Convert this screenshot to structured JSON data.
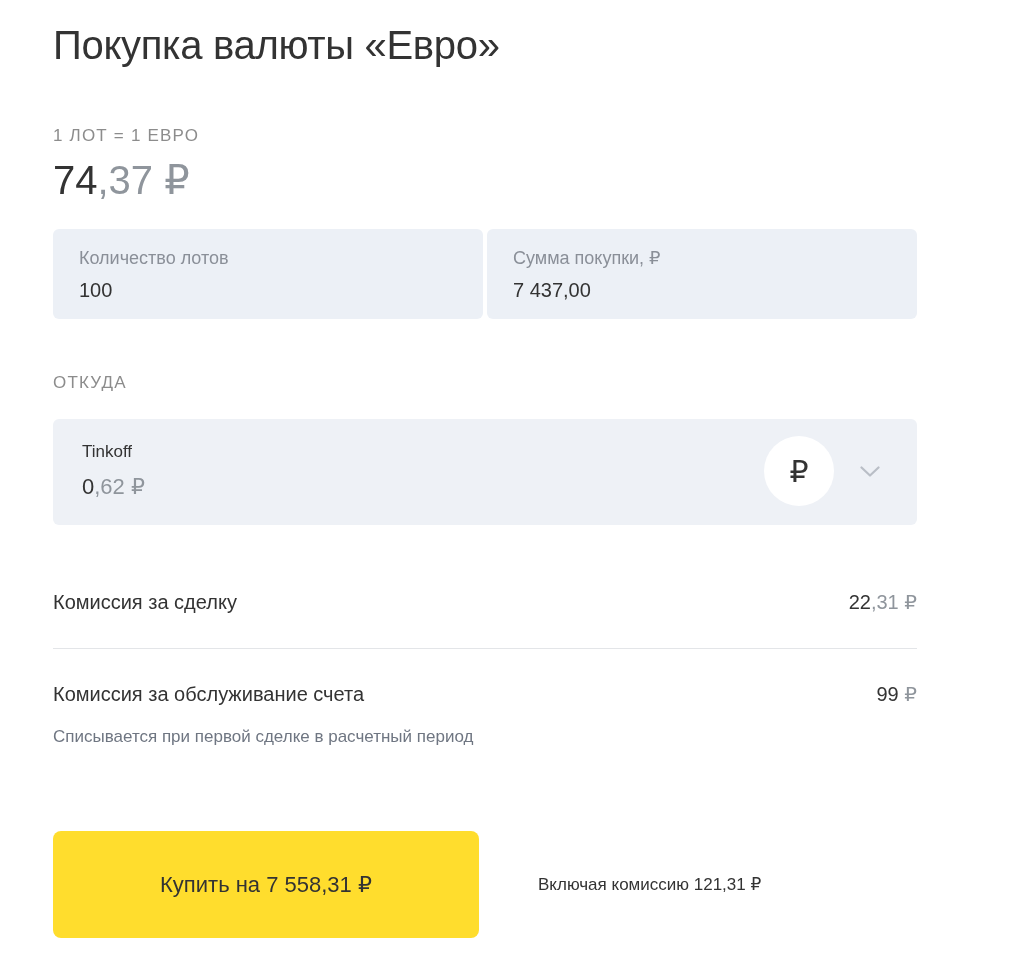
{
  "title": "Покупка валюты «Евро»",
  "rate": {
    "caption": "1 ЛОТ = 1 ЕВРО",
    "whole": "74",
    "fraction": ",37 ₽"
  },
  "fields": [
    {
      "label": "Количество лотов",
      "value": "100"
    },
    {
      "label": "Сумма покупки, ₽",
      "value": "7 437,00"
    }
  ],
  "source": {
    "heading": "ОТКУДА",
    "account": "Tinkoff",
    "balance_whole": "0",
    "balance_fraction": ",62 ₽",
    "currency_icon": "₽"
  },
  "fees": [
    {
      "label": "Комиссия за сделку",
      "whole": "22",
      "fraction": ",31 ₽"
    },
    {
      "label": "Комиссия за обслуживание счета",
      "whole": "99",
      "fraction": " ₽",
      "note": "Списывается при первой сделке в расчетный период"
    }
  ],
  "buy_button": "Купить на 7 558,31 ₽",
  "total_note": "Включая комиссию 121,31 ₽"
}
